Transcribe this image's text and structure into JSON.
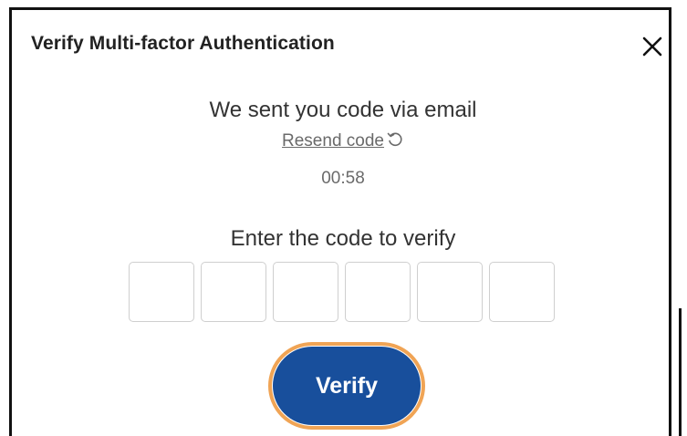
{
  "dialog": {
    "title": "Verify Multi-factor Authentication",
    "close_icon": "close-icon"
  },
  "message": {
    "sent_text": "We sent you code via email",
    "resend_label": "Resend code",
    "resend_icon": "refresh-icon",
    "timer": "00:58"
  },
  "code_entry": {
    "prompt": "Enter the code to verify",
    "digits": [
      "",
      "",
      "",
      "",
      "",
      ""
    ]
  },
  "actions": {
    "verify_label": "Verify"
  },
  "colors": {
    "primary": "#184f9c",
    "focus_ring": "#f0a455",
    "input_border": "#cfcfcf"
  }
}
